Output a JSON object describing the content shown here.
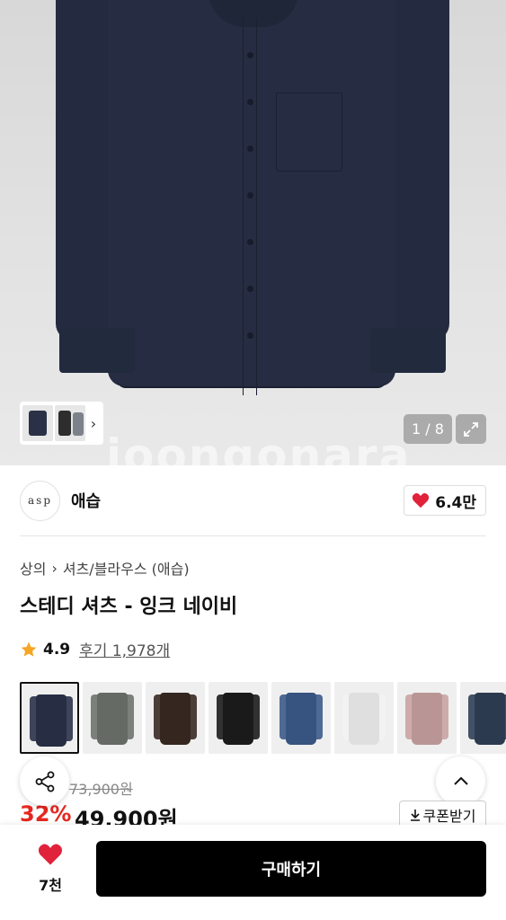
{
  "gallery": {
    "counter": "1 / 8",
    "watermark": "joongonara",
    "thumb_chevron": "›"
  },
  "brand": {
    "logo_text": "asp",
    "name": "애습",
    "likes": "6.4만"
  },
  "breadcrumb": {
    "category": "상의",
    "separator": "›",
    "subcategory": "셔츠/블라우스 (애습)"
  },
  "product": {
    "title": "스테디 셔츠 - 잉크 네이비",
    "rating": "4.9",
    "reviews": "후기 1,978개",
    "original_price": "73,900원",
    "discount": "32%",
    "sale_price": "49,900원"
  },
  "swatches": [
    {
      "color": "#2a3249",
      "selected": true
    },
    {
      "color": "#6e736e",
      "selected": false
    },
    {
      "color": "#3a2a22",
      "selected": false
    },
    {
      "color": "#1c1c1c",
      "selected": false
    },
    {
      "color": "#3c5a8a",
      "selected": false
    },
    {
      "color": "#f2f2f2",
      "selected": false
    },
    {
      "color": "#c9a3a2",
      "selected": false
    },
    {
      "color": "#2f3f55",
      "selected": false
    }
  ],
  "coupon": {
    "label": "쿠폰받기"
  },
  "bottom_bar": {
    "wish_count": "7천",
    "buy_label": "구매하기"
  },
  "colors": {
    "accent_red": "#e5271f",
    "heart_red": "#e0223a",
    "buy_bg": "#000000"
  }
}
